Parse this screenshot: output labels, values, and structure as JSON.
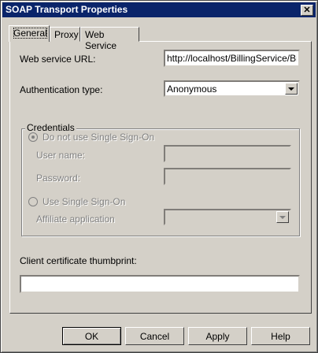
{
  "window": {
    "title": "SOAP Transport Properties",
    "close_glyph": "✕"
  },
  "tabs": [
    {
      "label": "General"
    },
    {
      "label": "Proxy"
    },
    {
      "label": "Web Service"
    }
  ],
  "general": {
    "url_label": "Web service URL:",
    "url_value": "http://localhost/BillingService/BillingService.asmx",
    "auth_label": "Authentication type:",
    "auth_value": "Anonymous",
    "credentials": {
      "title": "Credentials",
      "no_sso_label": "Do not use Single Sign-On",
      "user_name_label": "User name:",
      "password_label": "Password:",
      "use_sso_label": "Use Single Sign-On",
      "affiliate_label": "Affiliate application"
    },
    "thumbprint_label": "Client certificate thumbprint:",
    "thumbprint_value": ""
  },
  "buttons": {
    "ok": "OK",
    "cancel": "Cancel",
    "apply": "Apply",
    "help": "Help"
  }
}
